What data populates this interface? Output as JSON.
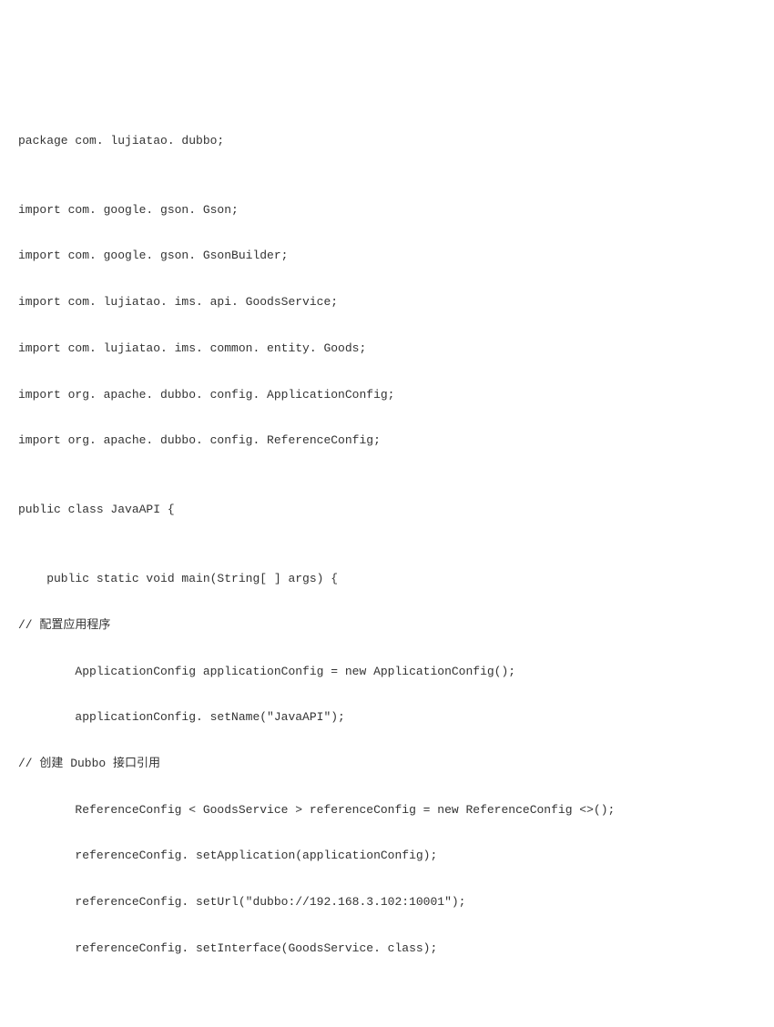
{
  "code": {
    "l1": "package com. lujiatao. dubbo;",
    "l2": "",
    "l3": "import com. google. gson. Gson;",
    "l4": "import com. google. gson. GsonBuilder;",
    "l5": "import com. lujiatao. ims. api. GoodsService;",
    "l6": "import com. lujiatao. ims. common. entity. Goods;",
    "l7": "import org. apache. dubbo. config. ApplicationConfig;",
    "l8": "import org. apache. dubbo. config. ReferenceConfig;",
    "l9": "",
    "l10": "public class JavaAPI {",
    "l11": "",
    "l12": "    public static void main(String[ ] args) {",
    "l13": "// 配置应用程序",
    "l14": "        ApplicationConfig applicationConfig = new ApplicationConfig();",
    "l15": "        applicationConfig. setName(\"JavaAPI\");",
    "l16": "// 创建 Dubbo 接口引用",
    "l17": "        ReferenceConfig < GoodsService > referenceConfig = new ReferenceConfig <>();",
    "l18": "        referenceConfig. setApplication(applicationConfig);",
    "l19": "        referenceConfig. setUrl(\"dubbo://192.168.3.102:10001\");",
    "l20": "        referenceConfig. setInterface(GoodsService. class);"
  }
}
